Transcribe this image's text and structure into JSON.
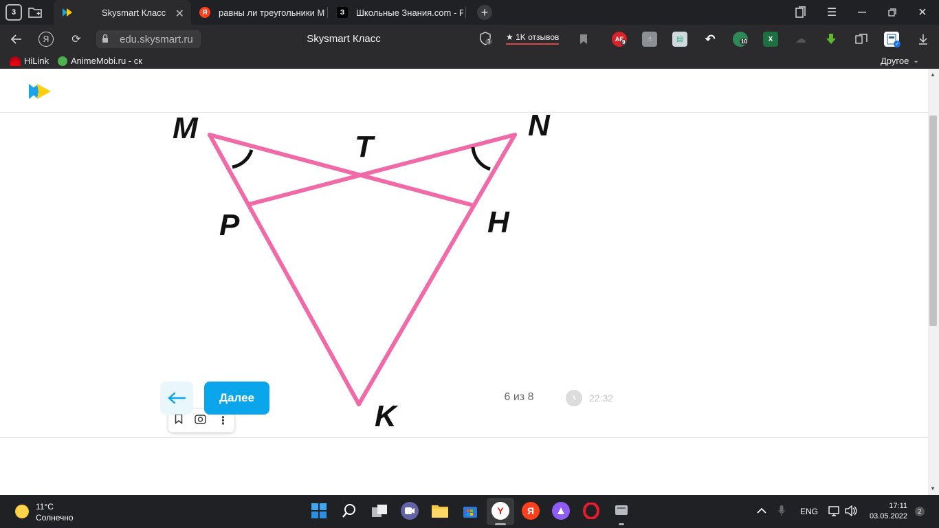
{
  "browser": {
    "tab_count_badge": "3",
    "tabs": [
      {
        "label": "Skysmart Класс",
        "active": true
      },
      {
        "label": "равны ли треугольники М",
        "active": false
      },
      {
        "label": "Школьные Знания.com - Р",
        "active": false
      }
    ],
    "favicon_yandex": "Я",
    "favicon_znania": "З",
    "address": "edu.skysmart.ru",
    "page_title": "Skysmart Класс",
    "shield_badge": "3",
    "reviews_label": "★ 1K отзывов",
    "ext_badge_ae": "AE",
    "ext_badge_ae_count": "9",
    "ext_badge_10": "10",
    "bookmarks": [
      {
        "label": "HiLink"
      },
      {
        "label": "AnimeMobi.ru - ск"
      }
    ],
    "bookmarks_other": "Другое"
  },
  "figure": {
    "labels": {
      "M": "M",
      "N": "N",
      "T": "T",
      "P": "P",
      "H": "H",
      "K": "K"
    },
    "line_color": "#f06aa8"
  },
  "footer": {
    "next_label": "Далее",
    "progress": "6 из 8",
    "timer": "22:32"
  },
  "taskbar": {
    "weather_temp": "11°C",
    "weather_desc": "Солнечно",
    "language": "ENG",
    "time": "17:11",
    "date": "03.05.2022",
    "notifications": "2",
    "yandex_letter": "Я"
  },
  "colors": {
    "accent": "#0aa5ea",
    "pink": "#f06aa8",
    "dark": "#202124"
  }
}
